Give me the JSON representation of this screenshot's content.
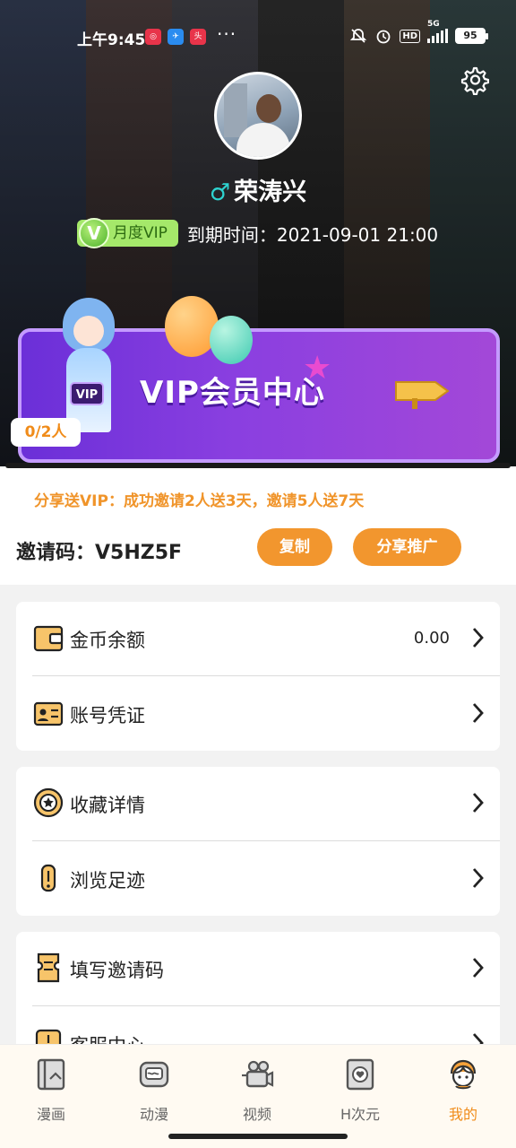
{
  "status_bar": {
    "time": "上午9:45",
    "battery": "95",
    "more": "···",
    "network": "5G",
    "hd": "HD"
  },
  "profile": {
    "name": "荣涛兴",
    "gender_symbol": "♂",
    "vip_badge_letter": "V",
    "vip_level": "月度VIP",
    "expire_text": "到期时间：2021-09-01 21:00"
  },
  "banner": {
    "title": "VIP会员中心",
    "tag": "VIP",
    "invite_count": "0/2人"
  },
  "invite": {
    "promo": "分享送VIP：成功邀请2人送3天，邀请5人送7天",
    "code_label": "邀请码：V5HZ5F",
    "copy_label": "复制",
    "share_label": "分享推广"
  },
  "menu_group_1": [
    {
      "label": "金币余额",
      "value": "0.00",
      "icon": "wallet-icon"
    },
    {
      "label": "账号凭证",
      "icon": "id-card-icon"
    }
  ],
  "menu_group_2": [
    {
      "label": "收藏详情",
      "icon": "favorite-icon"
    },
    {
      "label": "浏览足迹",
      "icon": "history-icon"
    }
  ],
  "menu_group_3": [
    {
      "label": "填写邀请码",
      "icon": "ticket-icon"
    },
    {
      "label": "客服中心",
      "icon": "service-icon"
    }
  ],
  "bottom_nav": [
    {
      "label": "漫画",
      "icon": "comic-book-icon"
    },
    {
      "label": "动漫",
      "icon": "tv-icon"
    },
    {
      "label": "视频",
      "icon": "video-camera-icon"
    },
    {
      "label": "H次元",
      "icon": "heart-card-icon"
    },
    {
      "label": "我的",
      "icon": "profile-avatar-icon",
      "active": true
    }
  ],
  "colors": {
    "accent": "#f2962e",
    "vip_green": "#a5e86a",
    "banner_purple": "#8a3fe0",
    "male_cyan": "#2ed3d0"
  }
}
